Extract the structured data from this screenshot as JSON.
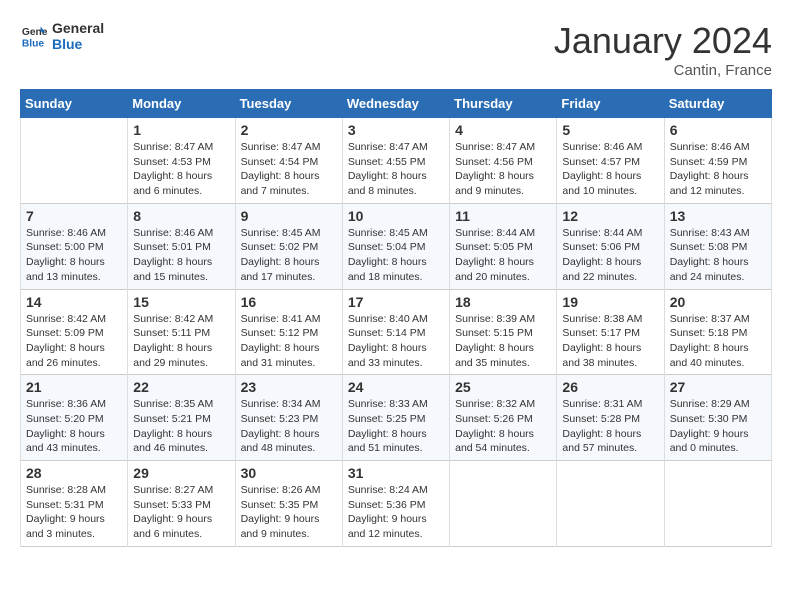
{
  "logo": {
    "line1": "General",
    "line2": "Blue"
  },
  "title": "January 2024",
  "location": "Cantin, France",
  "days_of_week": [
    "Sunday",
    "Monday",
    "Tuesday",
    "Wednesday",
    "Thursday",
    "Friday",
    "Saturday"
  ],
  "weeks": [
    [
      {
        "num": "",
        "info": ""
      },
      {
        "num": "1",
        "info": "Sunrise: 8:47 AM\nSunset: 4:53 PM\nDaylight: 8 hours\nand 6 minutes."
      },
      {
        "num": "2",
        "info": "Sunrise: 8:47 AM\nSunset: 4:54 PM\nDaylight: 8 hours\nand 7 minutes."
      },
      {
        "num": "3",
        "info": "Sunrise: 8:47 AM\nSunset: 4:55 PM\nDaylight: 8 hours\nand 8 minutes."
      },
      {
        "num": "4",
        "info": "Sunrise: 8:47 AM\nSunset: 4:56 PM\nDaylight: 8 hours\nand 9 minutes."
      },
      {
        "num": "5",
        "info": "Sunrise: 8:46 AM\nSunset: 4:57 PM\nDaylight: 8 hours\nand 10 minutes."
      },
      {
        "num": "6",
        "info": "Sunrise: 8:46 AM\nSunset: 4:59 PM\nDaylight: 8 hours\nand 12 minutes."
      }
    ],
    [
      {
        "num": "7",
        "info": "Sunrise: 8:46 AM\nSunset: 5:00 PM\nDaylight: 8 hours\nand 13 minutes."
      },
      {
        "num": "8",
        "info": "Sunrise: 8:46 AM\nSunset: 5:01 PM\nDaylight: 8 hours\nand 15 minutes."
      },
      {
        "num": "9",
        "info": "Sunrise: 8:45 AM\nSunset: 5:02 PM\nDaylight: 8 hours\nand 17 minutes."
      },
      {
        "num": "10",
        "info": "Sunrise: 8:45 AM\nSunset: 5:04 PM\nDaylight: 8 hours\nand 18 minutes."
      },
      {
        "num": "11",
        "info": "Sunrise: 8:44 AM\nSunset: 5:05 PM\nDaylight: 8 hours\nand 20 minutes."
      },
      {
        "num": "12",
        "info": "Sunrise: 8:44 AM\nSunset: 5:06 PM\nDaylight: 8 hours\nand 22 minutes."
      },
      {
        "num": "13",
        "info": "Sunrise: 8:43 AM\nSunset: 5:08 PM\nDaylight: 8 hours\nand 24 minutes."
      }
    ],
    [
      {
        "num": "14",
        "info": "Sunrise: 8:42 AM\nSunset: 5:09 PM\nDaylight: 8 hours\nand 26 minutes."
      },
      {
        "num": "15",
        "info": "Sunrise: 8:42 AM\nSunset: 5:11 PM\nDaylight: 8 hours\nand 29 minutes."
      },
      {
        "num": "16",
        "info": "Sunrise: 8:41 AM\nSunset: 5:12 PM\nDaylight: 8 hours\nand 31 minutes."
      },
      {
        "num": "17",
        "info": "Sunrise: 8:40 AM\nSunset: 5:14 PM\nDaylight: 8 hours\nand 33 minutes."
      },
      {
        "num": "18",
        "info": "Sunrise: 8:39 AM\nSunset: 5:15 PM\nDaylight: 8 hours\nand 35 minutes."
      },
      {
        "num": "19",
        "info": "Sunrise: 8:38 AM\nSunset: 5:17 PM\nDaylight: 8 hours\nand 38 minutes."
      },
      {
        "num": "20",
        "info": "Sunrise: 8:37 AM\nSunset: 5:18 PM\nDaylight: 8 hours\nand 40 minutes."
      }
    ],
    [
      {
        "num": "21",
        "info": "Sunrise: 8:36 AM\nSunset: 5:20 PM\nDaylight: 8 hours\nand 43 minutes."
      },
      {
        "num": "22",
        "info": "Sunrise: 8:35 AM\nSunset: 5:21 PM\nDaylight: 8 hours\nand 46 minutes."
      },
      {
        "num": "23",
        "info": "Sunrise: 8:34 AM\nSunset: 5:23 PM\nDaylight: 8 hours\nand 48 minutes."
      },
      {
        "num": "24",
        "info": "Sunrise: 8:33 AM\nSunset: 5:25 PM\nDaylight: 8 hours\nand 51 minutes."
      },
      {
        "num": "25",
        "info": "Sunrise: 8:32 AM\nSunset: 5:26 PM\nDaylight: 8 hours\nand 54 minutes."
      },
      {
        "num": "26",
        "info": "Sunrise: 8:31 AM\nSunset: 5:28 PM\nDaylight: 8 hours\nand 57 minutes."
      },
      {
        "num": "27",
        "info": "Sunrise: 8:29 AM\nSunset: 5:30 PM\nDaylight: 9 hours\nand 0 minutes."
      }
    ],
    [
      {
        "num": "28",
        "info": "Sunrise: 8:28 AM\nSunset: 5:31 PM\nDaylight: 9 hours\nand 3 minutes."
      },
      {
        "num": "29",
        "info": "Sunrise: 8:27 AM\nSunset: 5:33 PM\nDaylight: 9 hours\nand 6 minutes."
      },
      {
        "num": "30",
        "info": "Sunrise: 8:26 AM\nSunset: 5:35 PM\nDaylight: 9 hours\nand 9 minutes."
      },
      {
        "num": "31",
        "info": "Sunrise: 8:24 AM\nSunset: 5:36 PM\nDaylight: 9 hours\nand 12 minutes."
      },
      {
        "num": "",
        "info": ""
      },
      {
        "num": "",
        "info": ""
      },
      {
        "num": "",
        "info": ""
      }
    ]
  ]
}
